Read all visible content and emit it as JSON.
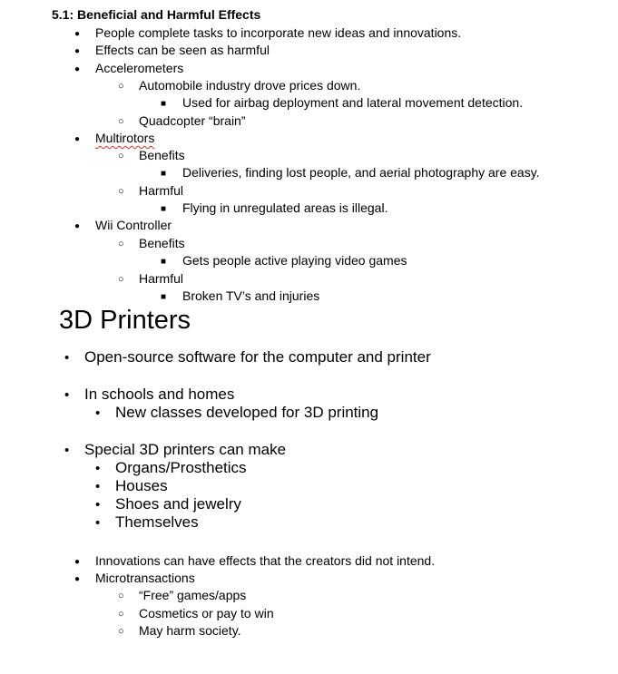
{
  "section": {
    "heading": "5.1: Beneficial and Harmful Effects",
    "items": [
      {
        "level": 1,
        "text": "People complete tasks to incorporate new ideas and innovations."
      },
      {
        "level": 1,
        "text": "Effects can be seen as harmful"
      },
      {
        "level": 1,
        "text": "Accelerometers"
      },
      {
        "level": 2,
        "text": "Automobile industry drove prices down."
      },
      {
        "level": 3,
        "text": "Used for airbag deployment and lateral movement detection."
      },
      {
        "level": 2,
        "text": "Quadcopter “brain”"
      },
      {
        "level": 1,
        "text": "Multirotors",
        "misspelled": true
      },
      {
        "level": 2,
        "text": "Benefits"
      },
      {
        "level": 3,
        "text": "Deliveries, finding lost people, and aerial photography are easy."
      },
      {
        "level": 2,
        "text": "Harmful"
      },
      {
        "level": 3,
        "text": "Flying in unregulated areas is illegal."
      },
      {
        "level": 1,
        "text": "Wii Controller"
      },
      {
        "level": 2,
        "text": "Benefits"
      },
      {
        "level": 3,
        "text": "Gets people active playing video games"
      },
      {
        "level": 2,
        "text": "Harmful"
      },
      {
        "level": 3,
        "text": "Broken TV’s and injuries"
      }
    ]
  },
  "slide": {
    "title": "3D Printers",
    "items": [
      {
        "level": 1,
        "text": "Open-source software for the computer and printer"
      },
      {
        "level": 1,
        "text": "In schools and homes"
      },
      {
        "level": 2,
        "text": "New classes developed for 3D printing"
      },
      {
        "level": 1,
        "text": "Special 3D printers can make"
      },
      {
        "level": 2,
        "text": "Organs/Prosthetics"
      },
      {
        "level": 2,
        "text": "Houses"
      },
      {
        "level": 2,
        "text": "Shoes and jewelry"
      },
      {
        "level": 2,
        "text": "Themselves"
      }
    ]
  },
  "trailing": {
    "items": [
      {
        "level": 1,
        "text": "Innovations can have effects that the creators did not intend."
      },
      {
        "level": 1,
        "text": "Microtransactions"
      },
      {
        "level": 2,
        "text": "“Free” games/apps"
      },
      {
        "level": 2,
        "text": "Cosmetics or pay to win"
      },
      {
        "level": 2,
        "text": "May harm society."
      }
    ]
  }
}
